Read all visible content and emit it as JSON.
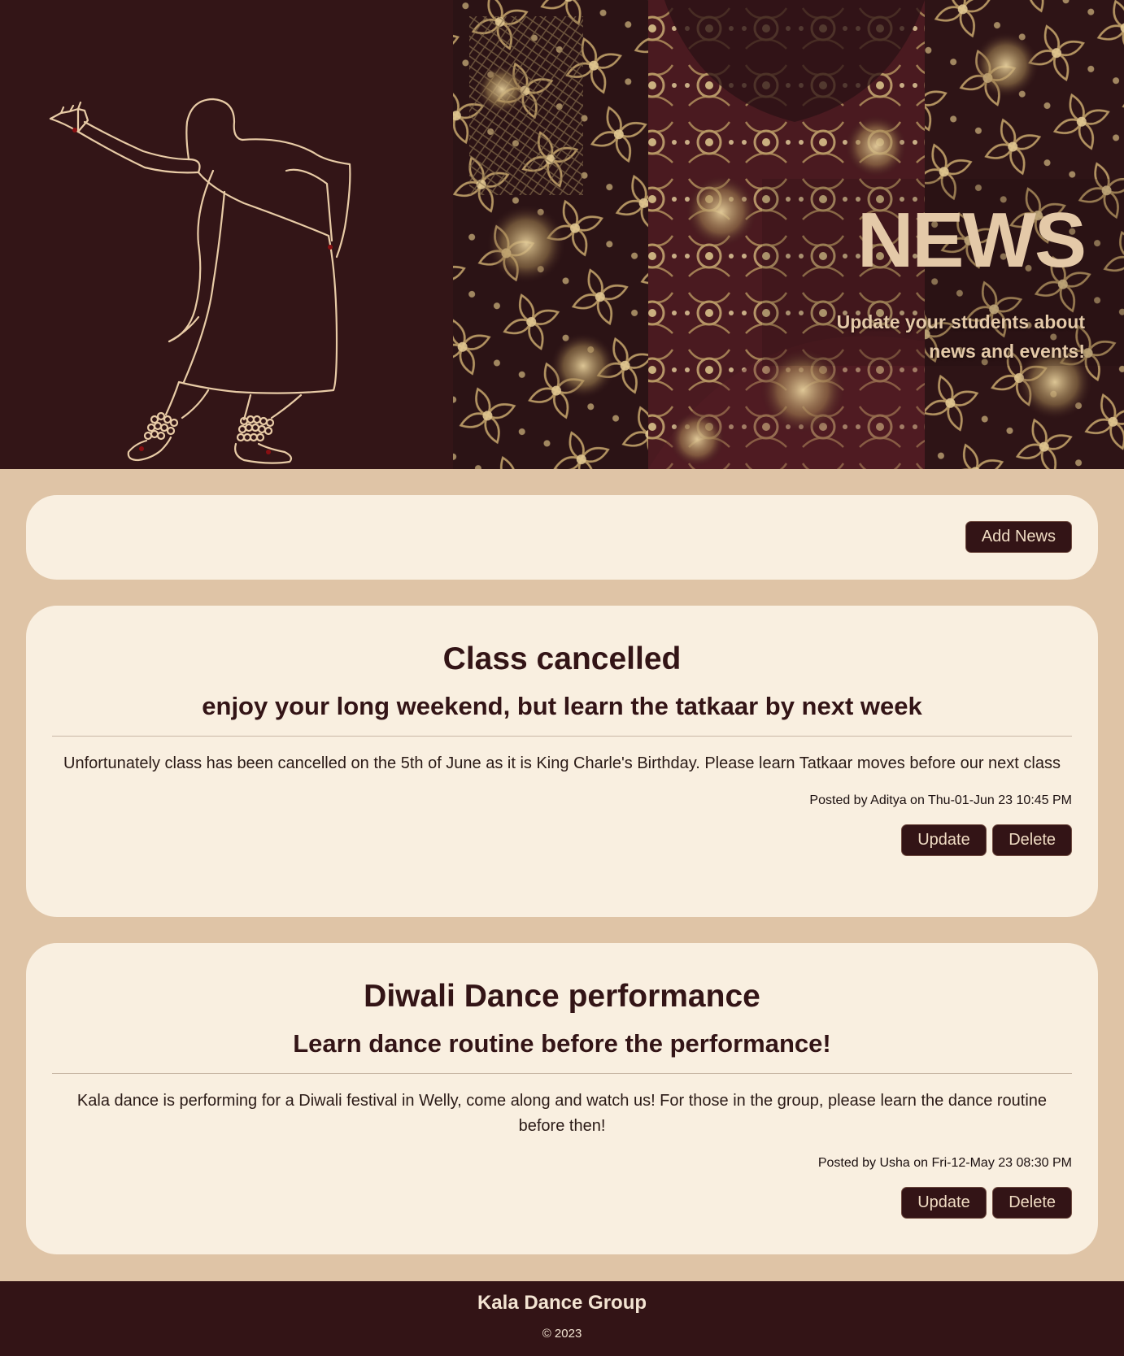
{
  "hero": {
    "title": "NEWS",
    "subtitle": "Update your students about news and events!"
  },
  "toolbar": {
    "add_label": "Add News"
  },
  "news": [
    {
      "title": "Class cancelled",
      "subtitle": "enjoy your long weekend, but learn the tatkaar by next week",
      "body": "Unfortunately class has been cancelled on the 5th of June as it is King Charle's Birthday. Please learn Tatkaar moves before our next class",
      "meta": "Posted by Aditya on Thu-01-Jun 23 10:45 PM",
      "update_label": "Update",
      "delete_label": "Delete"
    },
    {
      "title": "Diwali Dance performance",
      "subtitle": "Learn dance routine before the performance!",
      "body": "Kala dance is performing for a Diwali festival in Welly, come along and watch us! For those in the group, please learn the dance routine before then!",
      "meta": "Posted by Usha on Fri-12-May 23 08:30 PM",
      "update_label": "Update",
      "delete_label": "Delete"
    }
  ],
  "footer": {
    "title": "Kala Dance Group",
    "copyright": "© 2023"
  },
  "colors": {
    "maroon": "#331416",
    "cream": "#f9efe0",
    "tan": "#dfc4a6",
    "hero_text": "#e4c9a8"
  }
}
